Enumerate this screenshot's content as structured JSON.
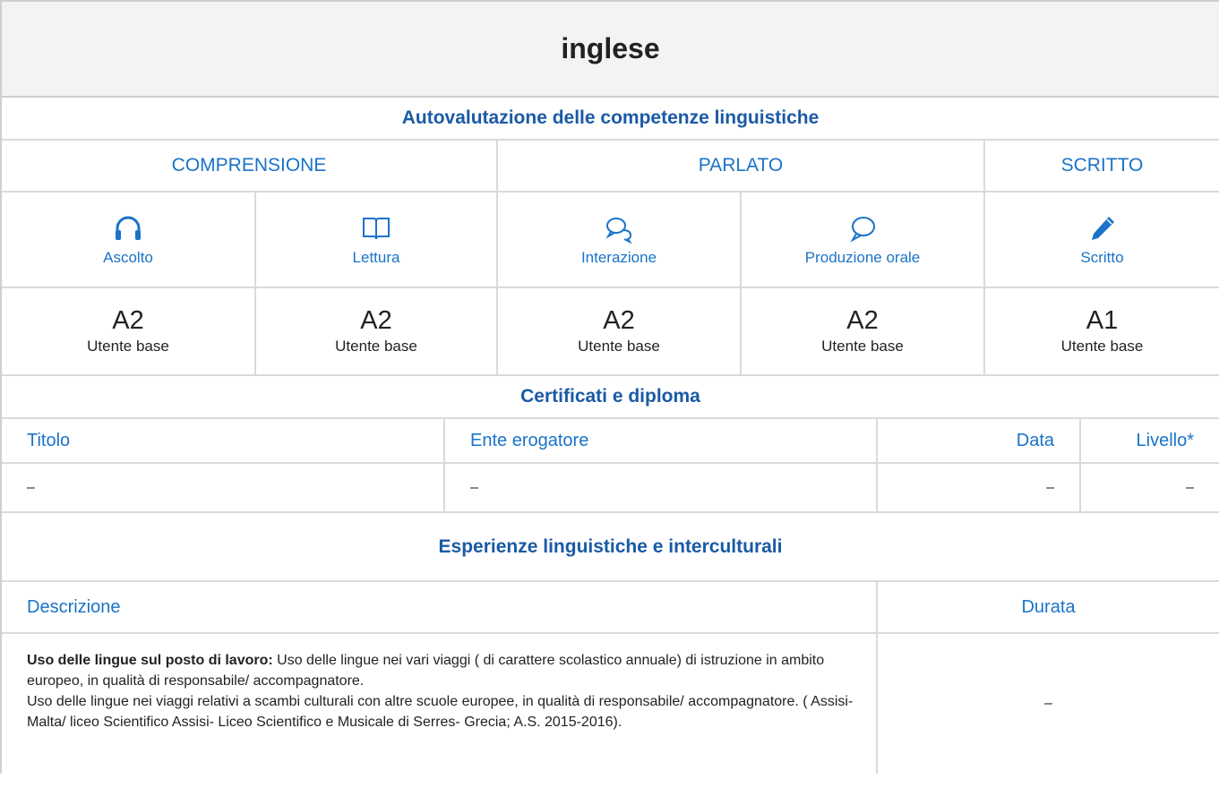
{
  "title": "inglese",
  "self_assessment": {
    "heading": "Autovalutazione delle competenze linguistiche",
    "categories": [
      "COMPRENSIONE",
      "PARLATO",
      "SCRITTO"
    ],
    "skills": [
      {
        "label": "Ascolto",
        "icon": "headphones-icon",
        "level": "A2",
        "level_desc": "Utente base"
      },
      {
        "label": "Lettura",
        "icon": "book-icon",
        "level": "A2",
        "level_desc": "Utente base"
      },
      {
        "label": "Interazione",
        "icon": "chat-bubbles-icon",
        "level": "A2",
        "level_desc": "Utente base"
      },
      {
        "label": "Produzione orale",
        "icon": "speech-bubble-icon",
        "level": "A2",
        "level_desc": "Utente base"
      },
      {
        "label": "Scritto",
        "icon": "pencil-icon",
        "level": "A1",
        "level_desc": "Utente base"
      }
    ]
  },
  "certificates": {
    "heading": "Certificati e diploma",
    "columns": [
      "Titolo",
      "Ente erogatore",
      "Data",
      "Livello*"
    ],
    "rows": [
      [
        "–",
        "–",
        "–",
        "–"
      ]
    ]
  },
  "experiences": {
    "heading": "Esperienze linguistiche e interculturali",
    "columns": [
      "Descrizione",
      "Durata"
    ],
    "entry": {
      "label": "Uso delle lingue sul posto di lavoro:",
      "line1": " Uso delle lingue nei vari viaggi ( di carattere scolastico annuale) di istruzione in ambito europeo, in qualità di responsabile/ accompagnatore.",
      "line2": "Uso delle lingue nei viaggi relativi a scambi culturali con altre scuole europee, in qualità di responsabile/ accompagnatore. ( Assisi- Malta/ liceo Scientifico Assisi- Liceo Scientifico e Musicale di Serres- Grecia; A.S. 2015-2016).",
      "duration": "–"
    }
  },
  "colors": {
    "accent": "#1a73c8",
    "heading_blue": "#1a5aa6",
    "border": "#dadada",
    "title_bg": "#f3f3f3"
  }
}
